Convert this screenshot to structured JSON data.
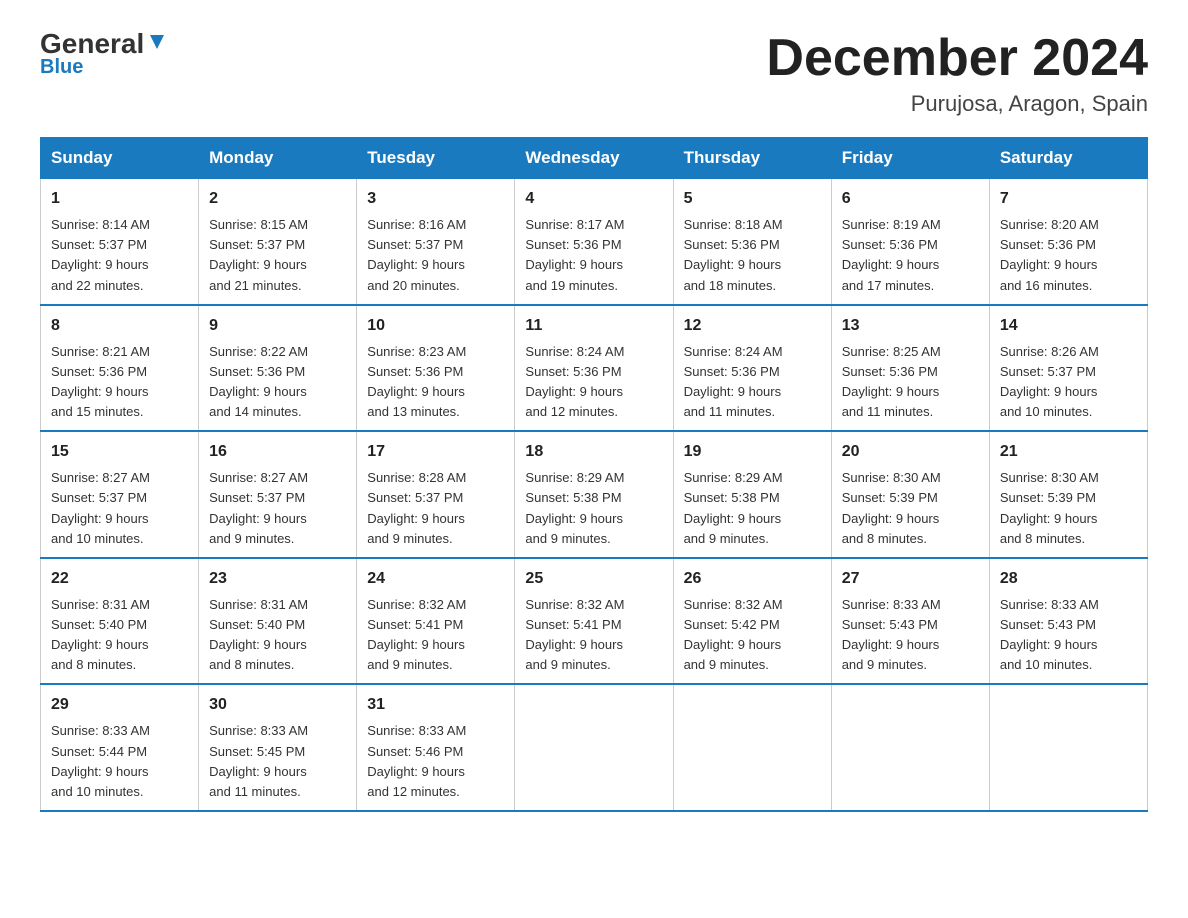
{
  "logo": {
    "general": "General",
    "blue": "Blue"
  },
  "title": "December 2024",
  "location": "Purujosa, Aragon, Spain",
  "days_of_week": [
    "Sunday",
    "Monday",
    "Tuesday",
    "Wednesday",
    "Thursday",
    "Friday",
    "Saturday"
  ],
  "weeks": [
    [
      {
        "day": "1",
        "sunrise": "8:14 AM",
        "sunset": "5:37 PM",
        "daylight": "9 hours and 22 minutes."
      },
      {
        "day": "2",
        "sunrise": "8:15 AM",
        "sunset": "5:37 PM",
        "daylight": "9 hours and 21 minutes."
      },
      {
        "day": "3",
        "sunrise": "8:16 AM",
        "sunset": "5:37 PM",
        "daylight": "9 hours and 20 minutes."
      },
      {
        "day": "4",
        "sunrise": "8:17 AM",
        "sunset": "5:36 PM",
        "daylight": "9 hours and 19 minutes."
      },
      {
        "day": "5",
        "sunrise": "8:18 AM",
        "sunset": "5:36 PM",
        "daylight": "9 hours and 18 minutes."
      },
      {
        "day": "6",
        "sunrise": "8:19 AM",
        "sunset": "5:36 PM",
        "daylight": "9 hours and 17 minutes."
      },
      {
        "day": "7",
        "sunrise": "8:20 AM",
        "sunset": "5:36 PM",
        "daylight": "9 hours and 16 minutes."
      }
    ],
    [
      {
        "day": "8",
        "sunrise": "8:21 AM",
        "sunset": "5:36 PM",
        "daylight": "9 hours and 15 minutes."
      },
      {
        "day": "9",
        "sunrise": "8:22 AM",
        "sunset": "5:36 PM",
        "daylight": "9 hours and 14 minutes."
      },
      {
        "day": "10",
        "sunrise": "8:23 AM",
        "sunset": "5:36 PM",
        "daylight": "9 hours and 13 minutes."
      },
      {
        "day": "11",
        "sunrise": "8:24 AM",
        "sunset": "5:36 PM",
        "daylight": "9 hours and 12 minutes."
      },
      {
        "day": "12",
        "sunrise": "8:24 AM",
        "sunset": "5:36 PM",
        "daylight": "9 hours and 11 minutes."
      },
      {
        "day": "13",
        "sunrise": "8:25 AM",
        "sunset": "5:36 PM",
        "daylight": "9 hours and 11 minutes."
      },
      {
        "day": "14",
        "sunrise": "8:26 AM",
        "sunset": "5:37 PM",
        "daylight": "9 hours and 10 minutes."
      }
    ],
    [
      {
        "day": "15",
        "sunrise": "8:27 AM",
        "sunset": "5:37 PM",
        "daylight": "9 hours and 10 minutes."
      },
      {
        "day": "16",
        "sunrise": "8:27 AM",
        "sunset": "5:37 PM",
        "daylight": "9 hours and 9 minutes."
      },
      {
        "day": "17",
        "sunrise": "8:28 AM",
        "sunset": "5:37 PM",
        "daylight": "9 hours and 9 minutes."
      },
      {
        "day": "18",
        "sunrise": "8:29 AM",
        "sunset": "5:38 PM",
        "daylight": "9 hours and 9 minutes."
      },
      {
        "day": "19",
        "sunrise": "8:29 AM",
        "sunset": "5:38 PM",
        "daylight": "9 hours and 9 minutes."
      },
      {
        "day": "20",
        "sunrise": "8:30 AM",
        "sunset": "5:39 PM",
        "daylight": "9 hours and 8 minutes."
      },
      {
        "day": "21",
        "sunrise": "8:30 AM",
        "sunset": "5:39 PM",
        "daylight": "9 hours and 8 minutes."
      }
    ],
    [
      {
        "day": "22",
        "sunrise": "8:31 AM",
        "sunset": "5:40 PM",
        "daylight": "9 hours and 8 minutes."
      },
      {
        "day": "23",
        "sunrise": "8:31 AM",
        "sunset": "5:40 PM",
        "daylight": "9 hours and 8 minutes."
      },
      {
        "day": "24",
        "sunrise": "8:32 AM",
        "sunset": "5:41 PM",
        "daylight": "9 hours and 9 minutes."
      },
      {
        "day": "25",
        "sunrise": "8:32 AM",
        "sunset": "5:41 PM",
        "daylight": "9 hours and 9 minutes."
      },
      {
        "day": "26",
        "sunrise": "8:32 AM",
        "sunset": "5:42 PM",
        "daylight": "9 hours and 9 minutes."
      },
      {
        "day": "27",
        "sunrise": "8:33 AM",
        "sunset": "5:43 PM",
        "daylight": "9 hours and 9 minutes."
      },
      {
        "day": "28",
        "sunrise": "8:33 AM",
        "sunset": "5:43 PM",
        "daylight": "9 hours and 10 minutes."
      }
    ],
    [
      {
        "day": "29",
        "sunrise": "8:33 AM",
        "sunset": "5:44 PM",
        "daylight": "9 hours and 10 minutes."
      },
      {
        "day": "30",
        "sunrise": "8:33 AM",
        "sunset": "5:45 PM",
        "daylight": "9 hours and 11 minutes."
      },
      {
        "day": "31",
        "sunrise": "8:33 AM",
        "sunset": "5:46 PM",
        "daylight": "9 hours and 12 minutes."
      },
      null,
      null,
      null,
      null
    ]
  ],
  "labels": {
    "sunrise": "Sunrise:",
    "sunset": "Sunset:",
    "daylight": "Daylight:"
  }
}
